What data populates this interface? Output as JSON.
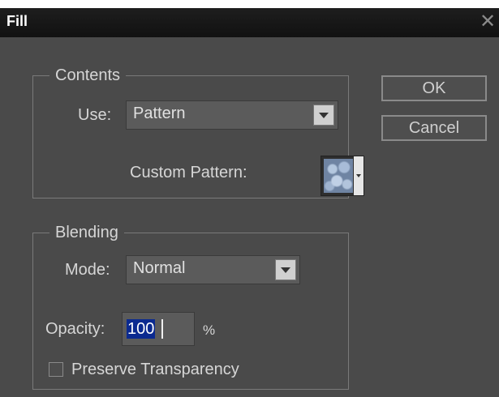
{
  "dialog": {
    "title": "Fill",
    "close_glyph": "✕"
  },
  "contents": {
    "legend": "Contents",
    "use_label": "Use:",
    "use_value": "Pattern",
    "custom_pattern_label": "Custom Pattern:"
  },
  "blending": {
    "legend": "Blending",
    "mode_label": "Mode:",
    "mode_value": "Normal",
    "opacity_label": "Opacity:",
    "opacity_value": "100",
    "percent": "%",
    "preserve_label": "Preserve Transparency",
    "preserve_checked": false
  },
  "buttons": {
    "ok": "OK",
    "cancel": "Cancel"
  },
  "colors": {
    "background": "#4a4a4a",
    "titlebar": "#151515",
    "selection": "#0b2a90"
  }
}
